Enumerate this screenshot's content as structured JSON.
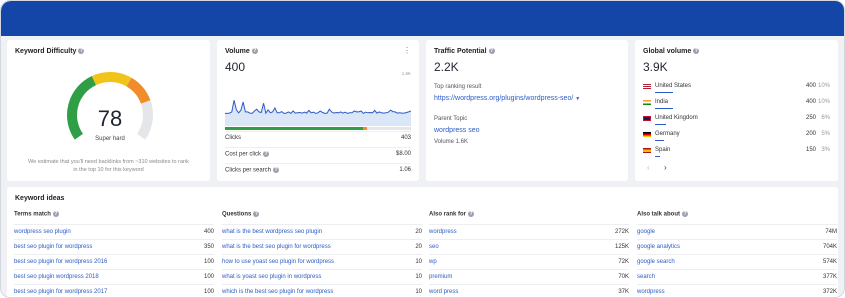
{
  "colors": {
    "brand": "#1446a8",
    "link": "#2c5cc5",
    "gauge_green": "#2f9e44",
    "gauge_yellow": "#f0c419",
    "gauge_orange": "#f08c2a"
  },
  "keyword_difficulty": {
    "title": "Keyword Difficulty",
    "score": "78",
    "score_value": 78,
    "label": "Super hard",
    "note_line1": "We estimate that you'll need backlinks from ~310 websites to rank",
    "note_line2": "in the top 10 for this keyword"
  },
  "volume": {
    "title": "Volume",
    "value": "400",
    "axis_max": "1.6K",
    "chart_values": [
      420,
      420,
      430,
      470,
      860,
      540,
      440,
      520,
      800,
      470,
      470,
      430,
      420,
      500,
      560,
      470,
      450,
      760,
      430,
      540,
      440,
      470,
      600,
      440,
      440,
      480,
      420,
      430,
      470,
      420,
      500,
      430,
      440,
      450,
      430,
      460,
      430,
      520,
      440,
      460,
      420,
      440,
      500,
      450,
      420,
      430,
      560,
      470,
      430,
      450,
      440,
      470,
      430,
      460,
      420,
      440,
      440,
      500,
      470,
      470,
      500,
      420,
      460,
      440,
      450,
      440,
      520,
      430,
      470,
      440,
      430,
      440,
      460,
      530,
      480,
      470,
      430,
      440,
      430,
      430,
      450,
      470,
      500
    ],
    "chart_max": 1600,
    "rows": [
      {
        "label": "Clicks",
        "value": "403"
      },
      {
        "label": "Cost per click",
        "value": "$8.00"
      },
      {
        "label": "Clicks per search",
        "value": "1.06"
      }
    ]
  },
  "traffic_potential": {
    "title": "Traffic Potential",
    "value": "2.2K",
    "top_result_label": "Top ranking result",
    "top_result_url": "https://wordpress.org/plugins/wordpress-seo/",
    "parent_topic_label": "Parent Topic",
    "parent_topic": "wordpress seo",
    "parent_volume": "Volume 1.6K"
  },
  "global_volume": {
    "title": "Global volume",
    "value": "3.9K",
    "countries": [
      {
        "name": "United States",
        "value": "400",
        "pct": "10%",
        "share": 0.1,
        "flag": "us"
      },
      {
        "name": "India",
        "value": "400",
        "pct": "10%",
        "share": 0.1,
        "flag": "in"
      },
      {
        "name": "United Kingdom",
        "value": "250",
        "pct": "6%",
        "share": 0.06,
        "flag": "uk"
      },
      {
        "name": "Germany",
        "value": "200",
        "pct": "5%",
        "share": 0.05,
        "flag": "de"
      },
      {
        "name": "Spain",
        "value": "150",
        "pct": "3%",
        "share": 0.03,
        "flag": "es"
      }
    ]
  },
  "keyword_ideas": {
    "title": "Keyword ideas",
    "columns": [
      {
        "header": "Terms match",
        "rows": [
          {
            "k": "wordpress seo plugin",
            "v": "400"
          },
          {
            "k": "best seo plugin for wordpress",
            "v": "350"
          },
          {
            "k": "best seo plugin for wordpress 2016",
            "v": "100"
          },
          {
            "k": "best seo plugin wordpress 2018",
            "v": "100"
          },
          {
            "k": "best seo plugin for wordpress 2017",
            "v": "100"
          }
        ]
      },
      {
        "header": "Questions",
        "rows": [
          {
            "k": "what is the best wordpress seo plugin",
            "v": "20"
          },
          {
            "k": "what is the best seo plugin for wordpress",
            "v": "20"
          },
          {
            "k": "how to use yoast seo plugin for wordpress",
            "v": "10"
          },
          {
            "k": "what is yoast seo plugin in wordpress",
            "v": "10"
          },
          {
            "k": "which is the best seo plugin for wordpress",
            "v": "10"
          }
        ]
      },
      {
        "header": "Also rank for",
        "rows": [
          {
            "k": "wordpress",
            "v": "272K"
          },
          {
            "k": "seo",
            "v": "125K"
          },
          {
            "k": "wp",
            "v": "72K"
          },
          {
            "k": "premium",
            "v": "70K"
          },
          {
            "k": "word press",
            "v": "37K"
          }
        ]
      },
      {
        "header": "Also talk about",
        "rows": [
          {
            "k": "google",
            "v": "74M"
          },
          {
            "k": "google analytics",
            "v": "704K"
          },
          {
            "k": "google search",
            "v": "574K"
          },
          {
            "k": "search",
            "v": "377K"
          },
          {
            "k": "wordpress",
            "v": "372K"
          }
        ]
      }
    ]
  }
}
